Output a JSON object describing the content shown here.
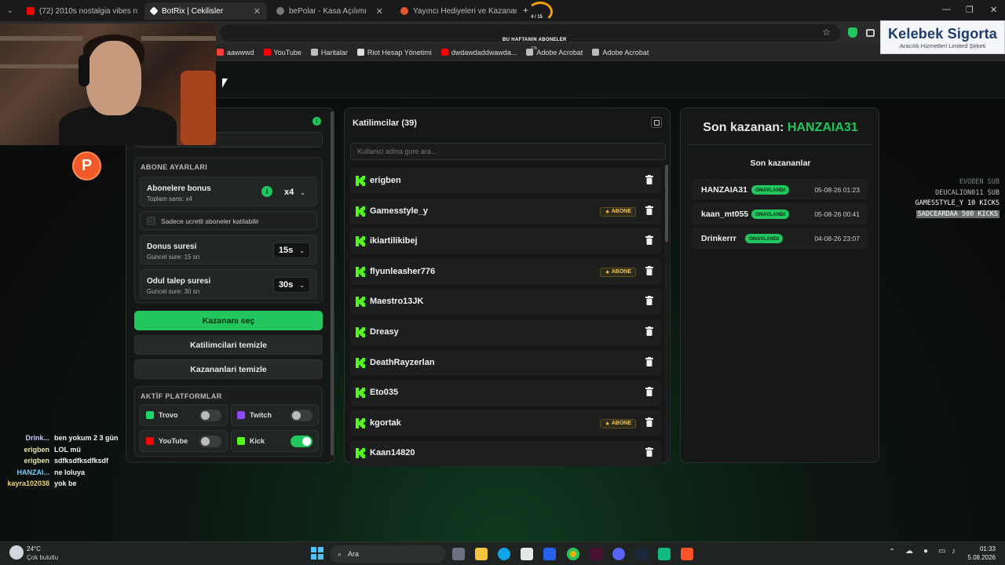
{
  "tabs": [
    {
      "title": "(72) 2010s nostalgia vibes n",
      "color": "#ff0000"
    },
    {
      "title": "BotRix | Cekilisler",
      "color": "#ffffff"
    },
    {
      "title": "bePolar - Kasa Açılımı",
      "color": "#888888"
    },
    {
      "title": "Yayıncı Hediyeleri ve Kazananlar",
      "color": "#e4572e"
    }
  ],
  "tab_plus": "+",
  "overlay_counter": "4 / 15",
  "bookmarks": [
    {
      "label": "aawwwd",
      "color": "#ff3b3b"
    },
    {
      "label": "YouTube",
      "color": "#ff0000"
    },
    {
      "label": "Haritalar",
      "color": "#bbbbbb"
    },
    {
      "label": "Riot Hesap Yönetimi",
      "color": "#dddddd"
    },
    {
      "label": "dwdawdaddwawda...",
      "color": "#ff0000"
    },
    {
      "label": "Adobe Acrobat",
      "color": "#bbbbbb"
    },
    {
      "label": "Adobe Acrobat",
      "color": "#bbbbbb"
    }
  ],
  "overlay_banner": "BU HAFTANIN ABONELER",
  "overlay_small": "27k",
  "logo": {
    "title": "Kelebek Sigorta",
    "subtitle": "Aracılık Hizmetleri Limited Şirketi"
  },
  "left": {
    "abone_header": "ABONE AYARLARI",
    "bonus": {
      "title": "Abonelere bonus",
      "sub": "Toplam sans: x4",
      "value": "x4"
    },
    "paid_only": "Sadece ucretli aboneler katilabilir",
    "dur": {
      "title": "Donus suresi",
      "sub": "Guncel sure: 15 sn",
      "value": "15s"
    },
    "claim": {
      "title": "Odul talep suresi",
      "sub": "Guncel sure: 30 sn",
      "value": "30s"
    },
    "btn_pick": "Kazananı seç",
    "btn_clear_participants": "Katilimcilari temizle",
    "btn_clear_winners": "Kazananlari temizle",
    "platform_header": "AKTİF PLATFORMLAR",
    "platforms": [
      {
        "name": "Trovo",
        "color": "#19d66b",
        "on": false
      },
      {
        "name": "Twitch",
        "color": "#9146ff",
        "on": false
      },
      {
        "name": "YouTube",
        "color": "#ff0000",
        "on": false
      },
      {
        "name": "Kick",
        "color": "#53fc18",
        "on": true
      }
    ]
  },
  "mid": {
    "title": "Katilimcilar (39)",
    "search_placeholder": "Kullanici adina gore ara...",
    "abone_label": "ABONE",
    "participants": [
      {
        "name": "erigben",
        "abone": false
      },
      {
        "name": "Gamesstyle_y",
        "abone": true
      },
      {
        "name": "ikiartilikibej",
        "abone": false
      },
      {
        "name": "flyunleasher776",
        "abone": true
      },
      {
        "name": "Maestro13JK",
        "abone": false
      },
      {
        "name": "Dreasy",
        "abone": false
      },
      {
        "name": "DeathRayzerlan",
        "abone": false
      },
      {
        "name": "Eto035",
        "abone": false
      },
      {
        "name": "kgortak",
        "abone": true
      },
      {
        "name": "Kaan14820",
        "abone": false
      }
    ]
  },
  "right": {
    "last_label": "Son kazanan:",
    "last_name": "HANZAIA31",
    "list_title": "Son kazananlar",
    "winners": [
      {
        "name": "HANZAIA31",
        "status": "ONAYLANDI",
        "date": "05-08-26 01:23"
      },
      {
        "name": "kaan_mt055",
        "status": "ONAYLANDI",
        "date": "05-08-26 00:41"
      },
      {
        "name": "Drinkerrr",
        "status": "ONAYLANDI",
        "date": "04-08-26 23:07"
      }
    ]
  },
  "subs": [
    {
      "text": "EVOBEN SUB",
      "color": "#7a7f7c",
      "bg": ""
    },
    {
      "text": "DEUCALION011 SUB",
      "color": "#b9bdba",
      "bg": ""
    },
    {
      "text": "GAMESSTYLE_Y 10 KICKS",
      "color": "#ffffff",
      "bg": ""
    },
    {
      "text": "SADCEARDAA 500 KICKS",
      "color": "#ffffff",
      "bg": "#6b6f6c"
    }
  ],
  "chat": [
    {
      "user": "Drink...",
      "msg": "ben yokum 2 3 gün",
      "color": "#c8c8ff"
    },
    {
      "user": "erigben",
      "msg": "LOL mü",
      "color": "#e8e6b0"
    },
    {
      "user": "erigben",
      "msg": "sdfksdfksdfksdf",
      "color": "#e8e6b0"
    },
    {
      "user": "HANZAI...",
      "msg": "ne loluya",
      "color": "#7ad0ff"
    },
    {
      "user": "kayra102038",
      "msg": "yok be",
      "color": "#f3d36b"
    }
  ],
  "weather": {
    "temp": "24°C",
    "desc": "Çok bulutlu"
  },
  "search_label": "Ara",
  "clock": {
    "time": "01:33",
    "date": "5.08.2026"
  }
}
